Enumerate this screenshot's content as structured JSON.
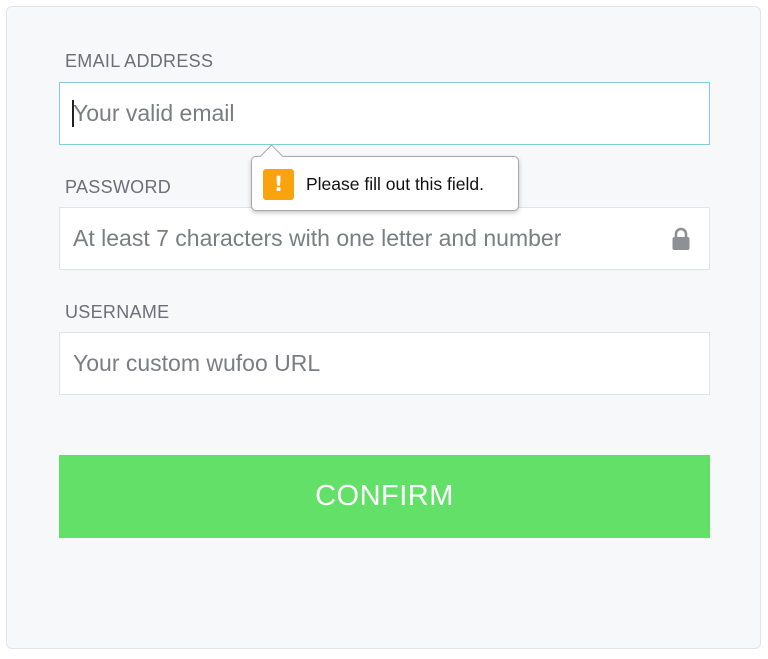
{
  "form": {
    "email": {
      "label": "EMAIL ADDRESS",
      "placeholder": "Your valid email",
      "value": ""
    },
    "password": {
      "label": "PASSWORD",
      "placeholder": "At least 7 characters with one letter and number",
      "value": "",
      "icon": "lock-icon"
    },
    "username": {
      "label": "USERNAME",
      "placeholder": "Your custom wufoo URL",
      "value": ""
    },
    "confirm_label": "CONFIRM"
  },
  "validation_tooltip": {
    "message": "Please fill out this field.",
    "icon": "warning-icon",
    "icon_glyph": "!",
    "icon_color": "#f9a30e"
  },
  "colors": {
    "confirm_button": "#62e068",
    "focus_border": "#7fcfd9",
    "card_background": "#f7f8fa"
  }
}
